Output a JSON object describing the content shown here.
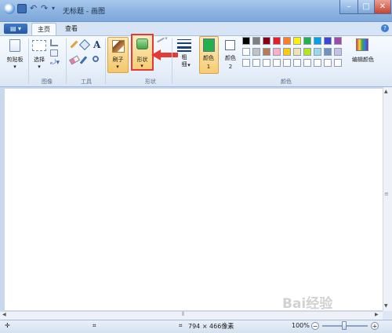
{
  "window": {
    "title": "无标题 - 画图",
    "minimize_symbol": "–",
    "maximize_symbol": "□",
    "close_symbol": "✕"
  },
  "ribbon": {
    "file_menu_label": "▤ ▾",
    "tabs": [
      {
        "label": "主页",
        "active": true
      },
      {
        "label": "查看",
        "active": false
      }
    ],
    "help_symbol": "?",
    "clipboard": {
      "paste_label": "剪贴板"
    },
    "image": {
      "select_label": "选择",
      "group_label": "图像"
    },
    "tools": {
      "group_label": "工具"
    },
    "brushes": {
      "label": "刷子"
    },
    "shapes": {
      "label": "形状",
      "group_label": "形状"
    },
    "size": {
      "label": "粗细"
    },
    "colors": {
      "color1_label": "颜色 1",
      "color2_label": "颜色 2",
      "edit_colors_label": "编辑颜色",
      "group_label": "颜色",
      "color1_value": "#22b14c",
      "color2_value": "#ffffff",
      "palette_row1": [
        "#000000",
        "#7f7f7f",
        "#880015",
        "#ed1c24",
        "#ff7f27",
        "#fff200",
        "#22b14c",
        "#00a2e8",
        "#3f48cc",
        "#a349a4"
      ],
      "palette_row2": [
        "#ffffff",
        "#c3c3c3",
        "#b97a57",
        "#ffaec9",
        "#ffc90e",
        "#efe4b0",
        "#b5e61d",
        "#99d9ea",
        "#7092be",
        "#c8bfe7"
      ],
      "palette_row3": [
        "#ffffff",
        "#ffffff",
        "#ffffff",
        "#ffffff",
        "#ffffff",
        "#ffffff",
        "#ffffff",
        "#ffffff",
        "#ffffff",
        "#ffffff"
      ]
    }
  },
  "accent": {
    "highlight": "#f2c95c",
    "annotation_red": "#e53935"
  },
  "status": {
    "image_size": "794 × 466像素",
    "zoom": "100%"
  },
  "watermark": "Bai经验"
}
